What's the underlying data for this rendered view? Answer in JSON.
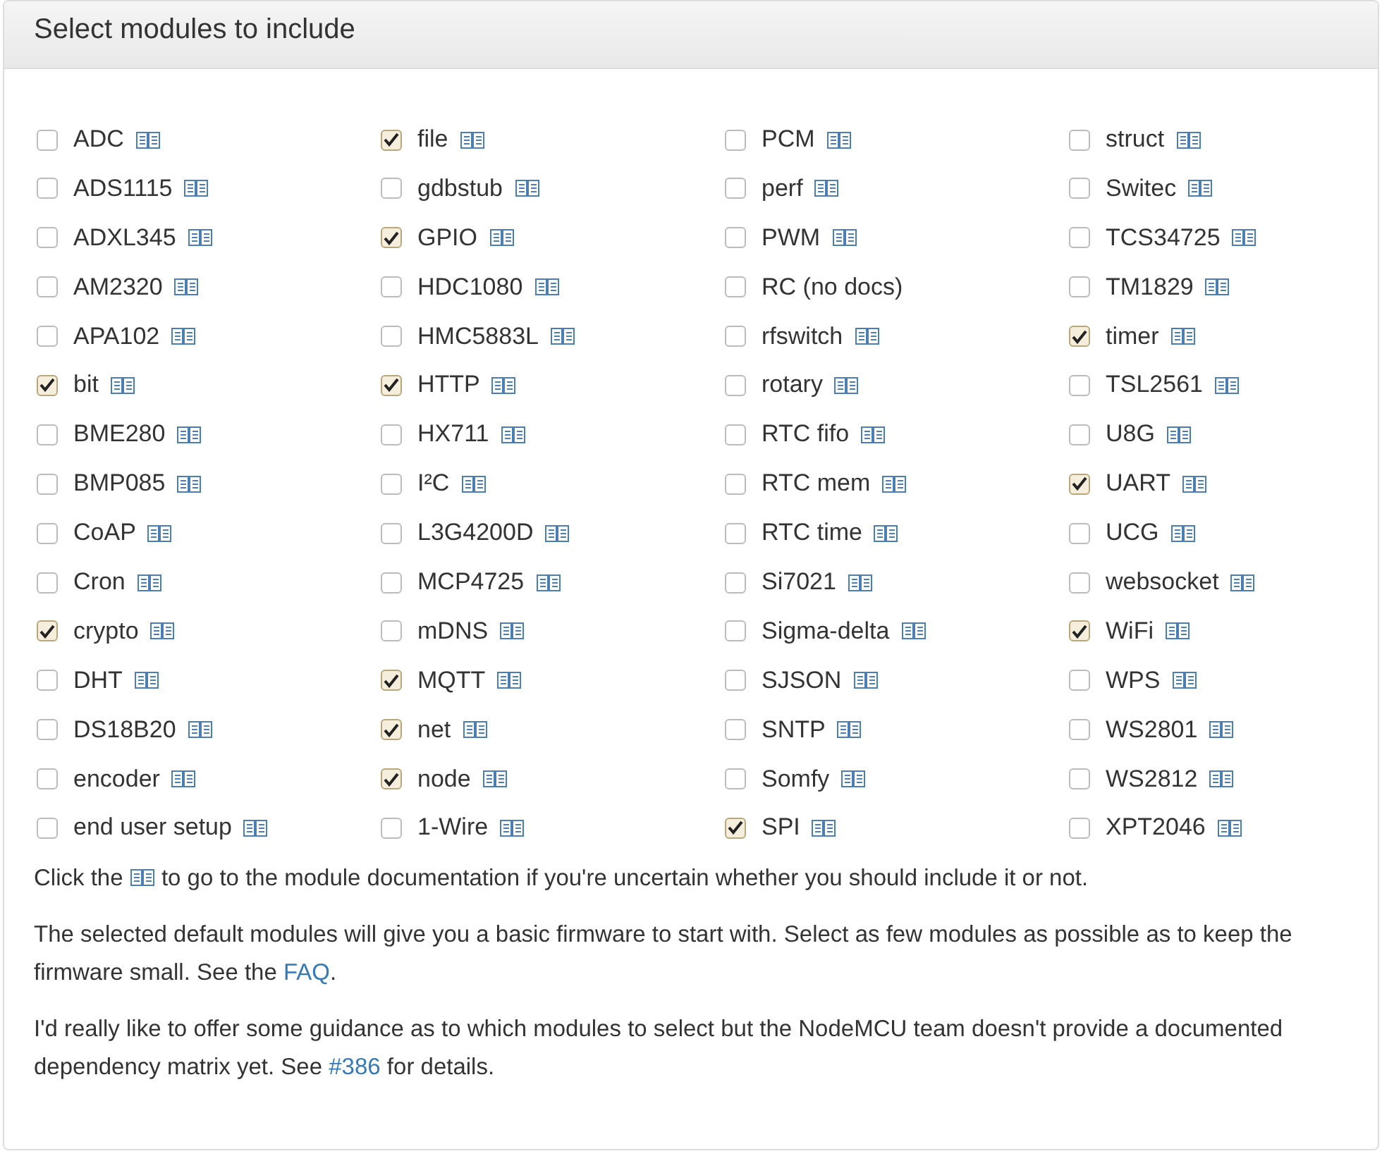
{
  "panel": {
    "title": "Select modules to include"
  },
  "modules": [
    {
      "name": "ADC",
      "checked": false,
      "has_docs": true
    },
    {
      "name": "ADS1115",
      "checked": false,
      "has_docs": true
    },
    {
      "name": "ADXL345",
      "checked": false,
      "has_docs": true
    },
    {
      "name": "AM2320",
      "checked": false,
      "has_docs": true
    },
    {
      "name": "APA102",
      "checked": false,
      "has_docs": true
    },
    {
      "name": "bit",
      "checked": true,
      "has_docs": true
    },
    {
      "name": "BME280",
      "checked": false,
      "has_docs": true
    },
    {
      "name": "BMP085",
      "checked": false,
      "has_docs": true
    },
    {
      "name": "CoAP",
      "checked": false,
      "has_docs": true
    },
    {
      "name": "Cron",
      "checked": false,
      "has_docs": true
    },
    {
      "name": "crypto",
      "checked": true,
      "has_docs": true
    },
    {
      "name": "DHT",
      "checked": false,
      "has_docs": true
    },
    {
      "name": "DS18B20",
      "checked": false,
      "has_docs": true
    },
    {
      "name": "encoder",
      "checked": false,
      "has_docs": true
    },
    {
      "name": "end user setup",
      "checked": false,
      "has_docs": true
    },
    {
      "name": "file",
      "checked": true,
      "has_docs": true
    },
    {
      "name": "gdbstub",
      "checked": false,
      "has_docs": true
    },
    {
      "name": "GPIO",
      "checked": true,
      "has_docs": true
    },
    {
      "name": "HDC1080",
      "checked": false,
      "has_docs": true
    },
    {
      "name": "HMC5883L",
      "checked": false,
      "has_docs": true
    },
    {
      "name": "HTTP",
      "checked": true,
      "has_docs": true
    },
    {
      "name": "HX711",
      "checked": false,
      "has_docs": true
    },
    {
      "name": "I²C",
      "checked": false,
      "has_docs": true
    },
    {
      "name": "L3G4200D",
      "checked": false,
      "has_docs": true
    },
    {
      "name": "MCP4725",
      "checked": false,
      "has_docs": true
    },
    {
      "name": "mDNS",
      "checked": false,
      "has_docs": true
    },
    {
      "name": "MQTT",
      "checked": true,
      "has_docs": true
    },
    {
      "name": "net",
      "checked": true,
      "has_docs": true
    },
    {
      "name": "node",
      "checked": true,
      "has_docs": true
    },
    {
      "name": "1-Wire",
      "checked": false,
      "has_docs": true
    },
    {
      "name": "PCM",
      "checked": false,
      "has_docs": true
    },
    {
      "name": "perf",
      "checked": false,
      "has_docs": true
    },
    {
      "name": "PWM",
      "checked": false,
      "has_docs": true
    },
    {
      "name": "RC (no docs)",
      "checked": false,
      "has_docs": false
    },
    {
      "name": "rfswitch",
      "checked": false,
      "has_docs": true
    },
    {
      "name": "rotary",
      "checked": false,
      "has_docs": true
    },
    {
      "name": "RTC fifo",
      "checked": false,
      "has_docs": true
    },
    {
      "name": "RTC mem",
      "checked": false,
      "has_docs": true
    },
    {
      "name": "RTC time",
      "checked": false,
      "has_docs": true
    },
    {
      "name": "Si7021",
      "checked": false,
      "has_docs": true
    },
    {
      "name": "Sigma-delta",
      "checked": false,
      "has_docs": true
    },
    {
      "name": "SJSON",
      "checked": false,
      "has_docs": true
    },
    {
      "name": "SNTP",
      "checked": false,
      "has_docs": true
    },
    {
      "name": "Somfy",
      "checked": false,
      "has_docs": true
    },
    {
      "name": "SPI",
      "checked": true,
      "has_docs": true
    },
    {
      "name": "struct",
      "checked": false,
      "has_docs": true
    },
    {
      "name": "Switec",
      "checked": false,
      "has_docs": true
    },
    {
      "name": "TCS34725",
      "checked": false,
      "has_docs": true
    },
    {
      "name": "TM1829",
      "checked": false,
      "has_docs": true
    },
    {
      "name": "timer",
      "checked": true,
      "has_docs": true
    },
    {
      "name": "TSL2561",
      "checked": false,
      "has_docs": true
    },
    {
      "name": "U8G",
      "checked": false,
      "has_docs": true
    },
    {
      "name": "UART",
      "checked": true,
      "has_docs": true
    },
    {
      "name": "UCG",
      "checked": false,
      "has_docs": true
    },
    {
      "name": "websocket",
      "checked": false,
      "has_docs": true
    },
    {
      "name": "WiFi",
      "checked": true,
      "has_docs": true
    },
    {
      "name": "WPS",
      "checked": false,
      "has_docs": true
    },
    {
      "name": "WS2801",
      "checked": false,
      "has_docs": true
    },
    {
      "name": "WS2812",
      "checked": false,
      "has_docs": true
    },
    {
      "name": "XPT2046",
      "checked": false,
      "has_docs": true
    }
  ],
  "paragraphs": [
    {
      "parts": [
        {
          "kind": "text",
          "text": "Click the "
        },
        {
          "kind": "icon"
        },
        {
          "kind": "text",
          "text": " to go to the module documentation if you're uncertain whether you should include it or not."
        }
      ]
    },
    {
      "parts": [
        {
          "kind": "text",
          "text": "The selected default modules will give you a basic firmware to start with. Select as few modules as possible as to keep the firmware small. See the "
        },
        {
          "kind": "link",
          "text": "FAQ"
        },
        {
          "kind": "text",
          "text": "."
        }
      ]
    },
    {
      "parts": [
        {
          "kind": "text",
          "text": "I'd really like to offer some guidance as to which modules to select but the NodeMCU team doesn't provide a documented dependency matrix yet. See "
        },
        {
          "kind": "link",
          "text": "#386"
        },
        {
          "kind": "text",
          "text": " for details."
        }
      ]
    }
  ]
}
